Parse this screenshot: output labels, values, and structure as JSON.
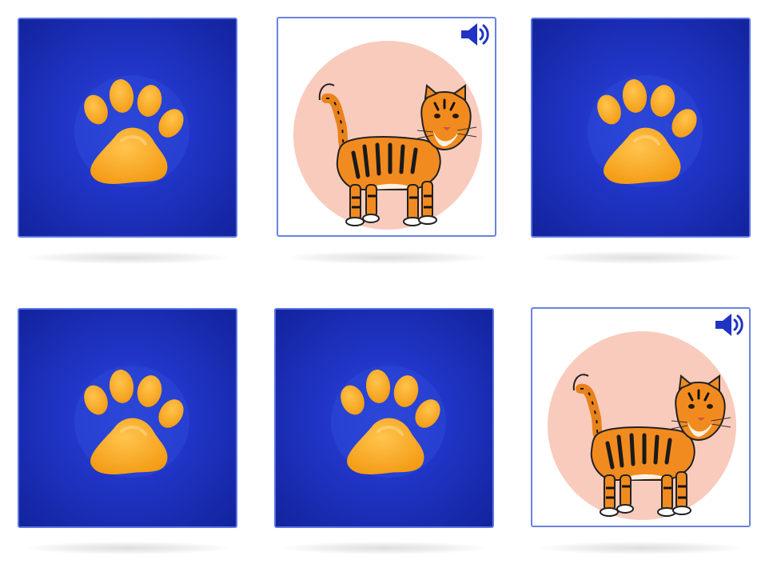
{
  "game": {
    "grid": {
      "rows": 2,
      "columns": 3
    },
    "cards": [
      {
        "state": "face-down",
        "icon": "paw-icon"
      },
      {
        "state": "face-up",
        "animal": "tiger",
        "icon": "tiger-image",
        "sound": "speaker-icon"
      },
      {
        "state": "face-down",
        "icon": "paw-icon"
      },
      {
        "state": "face-down",
        "icon": "paw-icon"
      },
      {
        "state": "face-down",
        "icon": "paw-icon"
      },
      {
        "state": "face-up",
        "animal": "tiger",
        "icon": "tiger-image",
        "sound": "speaker-icon"
      }
    ]
  },
  "colors": {
    "card_back": "#1f34c4",
    "card_border": "#5b76e0",
    "paw": "#f7a825",
    "tiger_circle": "#f9cbbd",
    "sound_icon": "#1f34c4"
  }
}
